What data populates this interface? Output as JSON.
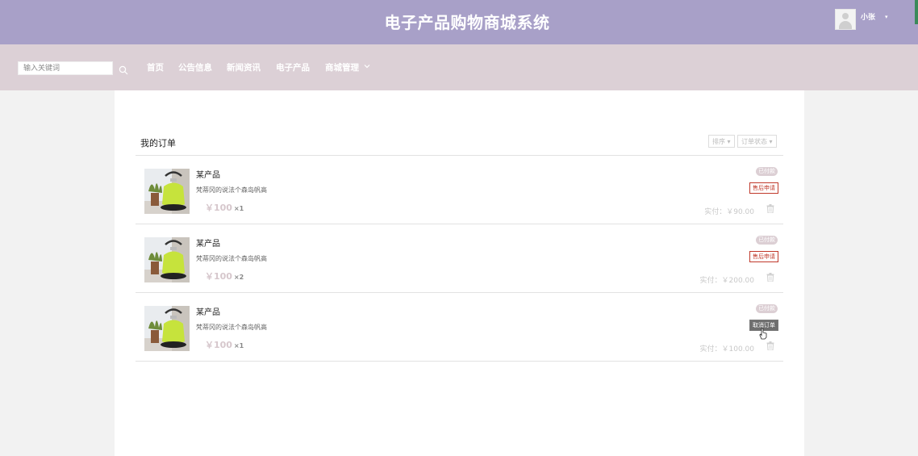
{
  "header": {
    "title": "电子产品购物商城系统",
    "user_name": "小张",
    "caret": "▾"
  },
  "search": {
    "placeholder": "输入关键词"
  },
  "nav": {
    "items": [
      "首页",
      "公告信息",
      "新闻资讯",
      "电子产品",
      "商城管理"
    ]
  },
  "orders": {
    "title": "我的订单",
    "sort_label": "排序",
    "status_filter_label": "订单状态",
    "caret": "▾",
    "paid_prefix": "实付：",
    "list": [
      {
        "name": "某产品",
        "desc": "梵蒂冈的说法个森岛帆高",
        "price": "￥100",
        "qty": "×1",
        "status": "已付款",
        "action": "售后申请",
        "paid_amount": "￥90.00"
      },
      {
        "name": "某产品",
        "desc": "梵蒂冈的说法个森岛帆高",
        "price": "￥100",
        "qty": "×2",
        "status": "已付款",
        "action": "售后申请",
        "paid_amount": "￥200.00"
      },
      {
        "name": "某产品",
        "desc": "梵蒂冈的说法个森岛帆高",
        "price": "￥100",
        "qty": "×1",
        "status": "已付款",
        "action": "取消订单",
        "paid_amount": "￥100.00"
      }
    ]
  },
  "colors": {
    "header_bg": "#a8a0c8",
    "navbar_bg": "#dcd0d6",
    "page_bg": "#f2f2f2",
    "accent_red": "#c0392b",
    "price_color": "#d6c7cc"
  },
  "icons": [
    "avatar-icon",
    "search-icon",
    "chevron-down-icon",
    "kettle-image",
    "trash-icon",
    "hand-cursor-icon"
  ]
}
